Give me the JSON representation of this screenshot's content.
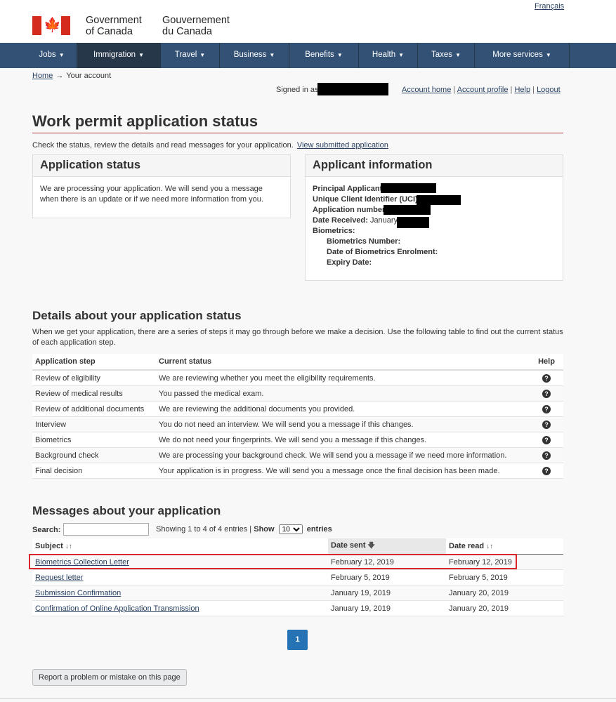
{
  "header": {
    "lang_link": "Français",
    "sig_en": "Government\nof Canada",
    "sig_fr": "Gouvernement\ndu Canada"
  },
  "nav": {
    "items": [
      {
        "label": "Jobs"
      },
      {
        "label": "Immigration"
      },
      {
        "label": "Travel"
      },
      {
        "label": "Business"
      },
      {
        "label": "Benefits"
      },
      {
        "label": "Health"
      },
      {
        "label": "Taxes"
      },
      {
        "label": "More services"
      }
    ],
    "caret": "▼"
  },
  "breadcrumb": {
    "home": "Home",
    "sep": "→",
    "current": "Your account"
  },
  "userbar": {
    "signed_in": "Signed in as",
    "links": [
      "Account home",
      "Account profile",
      "Help",
      "Logout"
    ]
  },
  "page": {
    "title": "Work permit application status",
    "intro": "Check the status, review the details and read messages for your application.",
    "view_link": "View submitted application"
  },
  "app_status": {
    "heading": "Application status",
    "text": "We are processing your application. We will send you a message when there is an update or if we need more information from you."
  },
  "applicant": {
    "heading": "Applicant information",
    "principal": "Principal Applicant:",
    "uci": "Unique Client Identifier (UCI):",
    "app_number": "Application number:",
    "date_received_label": "Date Received:",
    "date_received_value": "January",
    "biometrics": "Biometrics:",
    "bio_number": "Biometrics Number:",
    "bio_enrol": "Date of Biometrics Enrolment:",
    "expiry": "Expiry Date:"
  },
  "details": {
    "heading": "Details about your application status",
    "desc": "When we get your application, there are a series of steps it may go through before we make a decision. Use the following table to find out the current status of each application step.",
    "col_step": "Application step",
    "col_status": "Current status",
    "col_help": "Help",
    "help_glyph": "?",
    "rows": [
      {
        "step": "Review of eligibility",
        "status": "We are reviewing whether you meet the eligibility requirements."
      },
      {
        "step": "Review of medical results",
        "status": "You passed the medical exam."
      },
      {
        "step": "Review of additional documents",
        "status": "We are reviewing the additional documents you provided."
      },
      {
        "step": "Interview",
        "status": "You do not need an interview. We will send you a message if this changes."
      },
      {
        "step": "Biometrics",
        "status": "We do not need your fingerprints. We will send you a message if this changes."
      },
      {
        "step": "Background check",
        "status": "We are processing your background check. We will send you a message if we need more information."
      },
      {
        "step": "Final decision",
        "status": "Your application is in progress. We will send you a message once the final decision has been made."
      }
    ]
  },
  "messages": {
    "heading": "Messages about your application",
    "search_label": "Search:",
    "showing": "Showing 1 to 4 of 4 entries |",
    "show": "Show",
    "show_value": "10",
    "entries": "entries",
    "col_subject": "Subject",
    "col_sent": "Date sent",
    "col_read": "Date read",
    "sort_both": "↓↑",
    "sort_desc": "🡇",
    "rows": [
      {
        "subject": "Biometrics Collection Letter",
        "sent": "February 12, 2019",
        "read": "February 12, 2019"
      },
      {
        "subject": "Request letter",
        "sent": "February 5, 2019",
        "read": "February 5, 2019"
      },
      {
        "subject": "Submission Confirmation",
        "sent": "January 19, 2019",
        "read": "January 20, 2019"
      },
      {
        "subject": "Confirmation of Online Application Transmission",
        "sent": "January 19, 2019",
        "read": "January 20, 2019"
      }
    ],
    "page": "1"
  },
  "report_button": "Report a problem or mistake on this page",
  "colors": {
    "nav": "#335075",
    "nav_active": "#26374a",
    "accent_red": "#d52b1e",
    "highlight": "#d8272d",
    "pager": "#2572b4"
  }
}
